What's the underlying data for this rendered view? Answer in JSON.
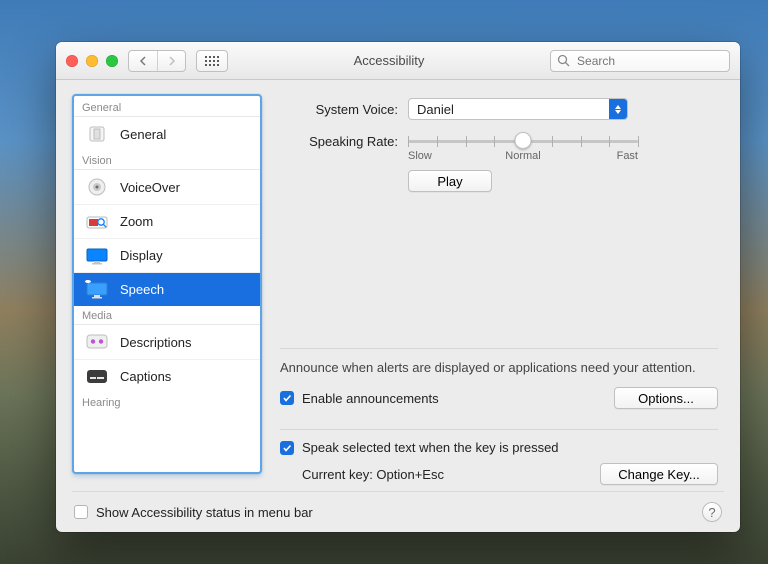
{
  "window": {
    "title": "Accessibility"
  },
  "search": {
    "placeholder": "Search"
  },
  "sidebar": {
    "groups": {
      "general": "General",
      "vision": "Vision",
      "media": "Media",
      "hearing": "Hearing"
    },
    "items": {
      "general": "General",
      "voiceover": "VoiceOver",
      "zoom": "Zoom",
      "display": "Display",
      "speech": "Speech",
      "descriptions": "Descriptions",
      "captions": "Captions"
    },
    "selected": "speech"
  },
  "speech": {
    "system_voice_label": "System Voice:",
    "system_voice_value": "Daniel",
    "speaking_rate_label": "Speaking Rate:",
    "rate_slow": "Slow",
    "rate_normal": "Normal",
    "rate_fast": "Fast",
    "play_button": "Play",
    "announce_note": "Announce when alerts are displayed or applications need your attention.",
    "enable_announcements_label": "Enable announcements",
    "enable_announcements_checked": true,
    "options_button": "Options...",
    "speak_selected_label": "Speak selected text when the key is pressed",
    "speak_selected_checked": true,
    "current_key_label": "Current key: Option+Esc",
    "change_key_button": "Change Key..."
  },
  "footer": {
    "show_status_label": "Show Accessibility status in menu bar",
    "show_status_checked": false
  }
}
